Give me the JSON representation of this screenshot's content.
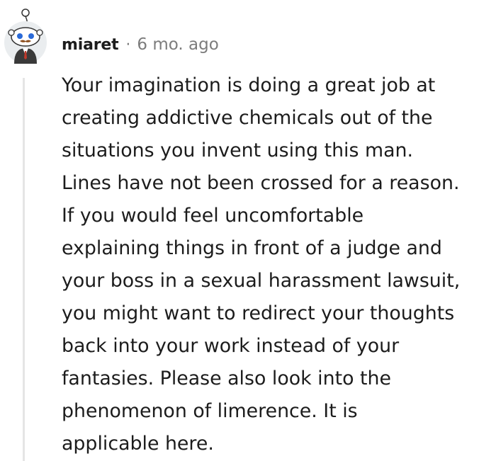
{
  "comment": {
    "author": "miaret",
    "separator": "·",
    "timestamp": "6 mo. ago",
    "lines": [
      "Your imagination is doing a great job at",
      "creating addictive chemicals out of the",
      "situations you invent using this man.",
      "Lines have not been crossed for a reason.",
      "If you would feel uncomfortable",
      "explaining things in front of a judge and",
      "your boss in a sexual harassment lawsuit,",
      "you might want to redirect your thoughts",
      "back into your work instead of your",
      "fantasies. Please also look into the",
      "phenomenon of limerence. It is",
      "applicable here."
    ]
  },
  "icons": {
    "avatar": "snoo-avatar-icon"
  },
  "colors": {
    "text": "#1c1c1c",
    "meta": "#7c7c7c",
    "thread_line": "#e5e5e5",
    "avatar_bg": "#eaedef"
  }
}
